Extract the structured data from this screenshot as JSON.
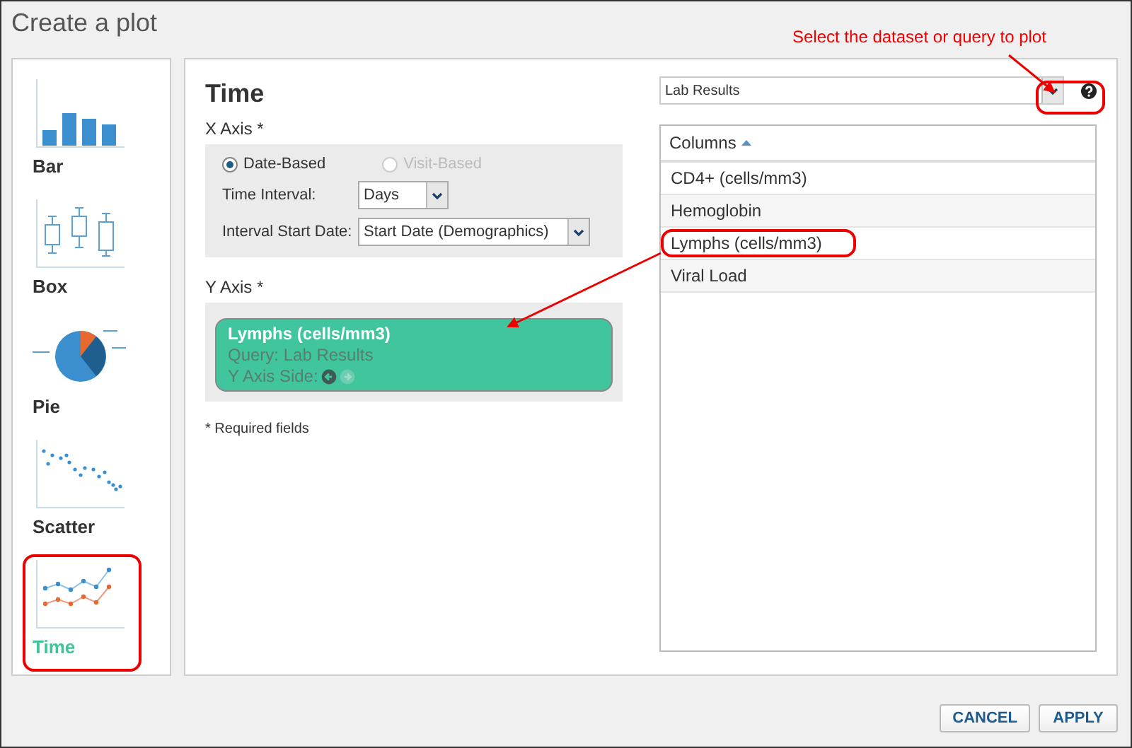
{
  "window": {
    "title": "Create a plot"
  },
  "chart_types": [
    {
      "kind": "bar",
      "label": "Bar",
      "selected": false,
      "circled": false
    },
    {
      "kind": "box",
      "label": "Box",
      "selected": false,
      "circled": false
    },
    {
      "kind": "pie",
      "label": "Pie",
      "selected": false,
      "circled": false
    },
    {
      "kind": "scatter",
      "label": "Scatter",
      "selected": false,
      "circled": false
    },
    {
      "kind": "time",
      "label": "Time",
      "selected": true,
      "circled": true
    }
  ],
  "panel": {
    "title": "Time",
    "x_axis": {
      "label": "X Axis *",
      "options": [
        {
          "label": "Date-Based",
          "selected": true,
          "disabled": false
        },
        {
          "label": "Visit-Based",
          "selected": false,
          "disabled": true
        }
      ],
      "time_interval": {
        "label": "Time Interval:",
        "value": "Days"
      },
      "interval_start": {
        "label": "Interval Start Date:",
        "value": "Start Date (Demographics)"
      }
    },
    "y_axis": {
      "label": "Y Axis *",
      "measure": {
        "name": "Lymphs (cells/mm3)",
        "query": "Query: Lab Results",
        "side_label": "Y Axis Side:",
        "sides": [
          {
            "selected": true
          },
          {
            "selected": false
          }
        ]
      }
    },
    "required_note": "* Required fields"
  },
  "dataset_select": {
    "value": "Lab Results",
    "circled": true
  },
  "columns": {
    "header": "Columns",
    "items": [
      {
        "label": "CD4+ (cells/mm3)",
        "circled": false
      },
      {
        "label": "Hemoglobin",
        "circled": false
      },
      {
        "label": "Lymphs (cells/mm3)",
        "circled": true
      },
      {
        "label": "Viral Load",
        "circled": false
      }
    ]
  },
  "buttons": [
    "CANCEL",
    "APPLY"
  ],
  "annotation": {
    "text": "Select the dataset or query to plot"
  }
}
